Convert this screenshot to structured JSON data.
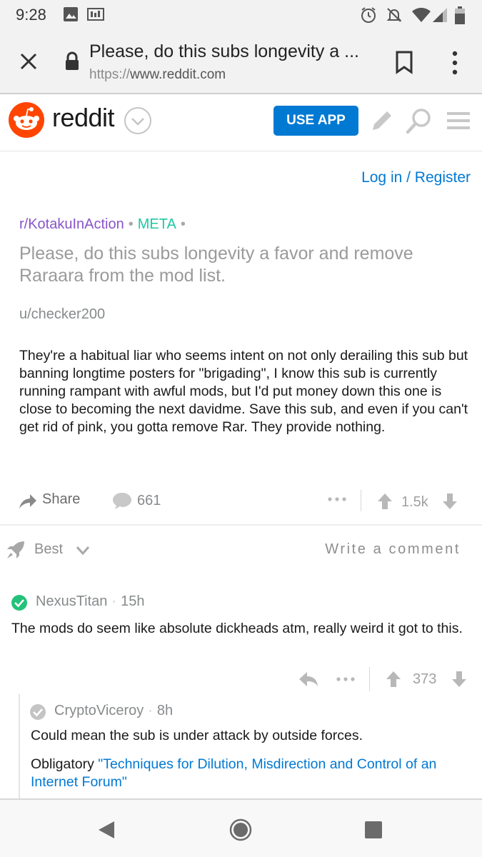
{
  "status_bar": {
    "time": "9:28",
    "icons": [
      "image-icon",
      "news-icon",
      "alarm-icon",
      "notifications-off-icon",
      "wifi-icon",
      "signal-icon",
      "battery-icon"
    ]
  },
  "browser": {
    "page_title": "Please, do this subs longevity a ...",
    "url_protocol": "https://",
    "url_host": "www.reddit.com",
    "icons": [
      "close-icon",
      "lock-icon",
      "bookmark-icon",
      "more-vert-icon"
    ]
  },
  "reddit_header": {
    "wordmark": "reddit",
    "use_app_label": "USE APP",
    "brand_color": "#ff4500",
    "accent_color": "#0079d3",
    "icons": [
      "snoo-logo-icon",
      "chevron-down-icon",
      "pencil-icon",
      "search-icon",
      "menu-icon"
    ]
  },
  "auth": {
    "login_register": "Log in / Register"
  },
  "post": {
    "subreddit": "r/KotakuInAction",
    "flair": "META",
    "title": "Please, do this subs longevity a favor and remove Raraara from the mod list.",
    "author": "u/checker200",
    "body": "They're a habitual liar who seems intent on not only derailing this sub but banning longtime posters for \"brigading\", I know this sub is currently running rampant with awful mods, but I'd put money down this one is close to becoming the next davidme. Save this sub, and even if you can't get rid of pink, you gotta remove Rar. They provide nothing.",
    "share_label": "Share",
    "comment_count": "661",
    "score": "1.5k"
  },
  "comments_bar": {
    "sort_label": "Best",
    "write_comment": "Write a comment"
  },
  "comments": [
    {
      "user": "NexusTitan",
      "age": "15h",
      "body": "The mods do seem like absolute dickheads atm, really weird it got to this.",
      "score": "373",
      "verified_color": "#24c17a"
    },
    {
      "user": "CryptoViceroy",
      "age": "8h",
      "body": "Could mean the sub is under attack by outside forces.",
      "body2_prefix": "Obligatory ",
      "body2_link": "\"Techniques for Dilution, Misdirection and Control of an Internet Forum\""
    }
  ],
  "system_nav": {
    "icons": [
      "back-icon",
      "home-icon",
      "recents-icon"
    ]
  }
}
